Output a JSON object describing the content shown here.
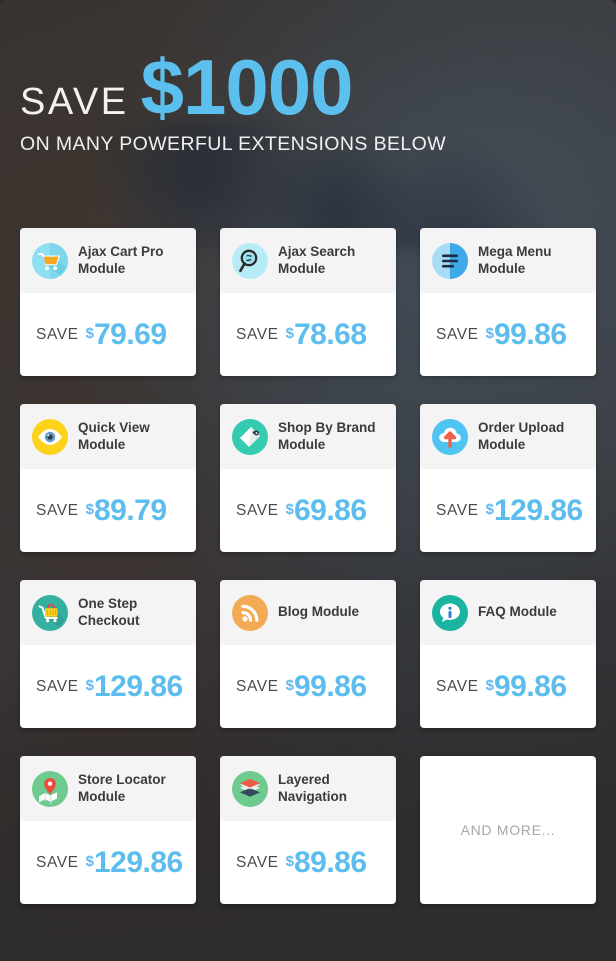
{
  "hero": {
    "save_word": "SAVE",
    "amount": "$1000",
    "subtitle": "ON MANY POWERFUL EXTENSIONS BELOW"
  },
  "labels": {
    "save": "SAVE",
    "currency": "$"
  },
  "colors": {
    "accent_blue": "#5cbdee",
    "card_header_bg": "#f4f4f5",
    "card_bg": "#ffffff",
    "title_text": "#3b3b3b",
    "background_dark": "#343230"
  },
  "cards": [
    {
      "title": "Ajax Cart Pro Module",
      "icon": "shopping-cart-icon",
      "save_label": "SAVE",
      "currency": "$",
      "value": "79.69"
    },
    {
      "title": "Ajax Search Module",
      "icon": "magnifier-search-icon",
      "save_label": "SAVE",
      "currency": "$",
      "value": "78.68"
    },
    {
      "title": "Mega Menu Module",
      "icon": "menu-lines-icon",
      "save_label": "SAVE",
      "currency": "$",
      "value": "99.86"
    },
    {
      "title": "Quick View Module",
      "icon": "eye-icon",
      "save_label": "SAVE",
      "currency": "$",
      "value": "89.79"
    },
    {
      "title": "Shop By Brand Module",
      "icon": "price-tag-icon",
      "save_label": "SAVE",
      "currency": "$",
      "value": "69.86"
    },
    {
      "title": "Order Upload Module",
      "icon": "cloud-upload-icon",
      "save_label": "SAVE",
      "currency": "$",
      "value": "129.86"
    },
    {
      "title": "One Step Checkout",
      "icon": "shopping-basket-icon",
      "save_label": "SAVE",
      "currency": "$",
      "value": "129.86"
    },
    {
      "title": "Blog Module",
      "icon": "rss-feed-icon",
      "save_label": "SAVE",
      "currency": "$",
      "value": "99.86"
    },
    {
      "title": "FAQ Module",
      "icon": "info-bubble-icon",
      "save_label": "SAVE",
      "currency": "$",
      "value": "99.86"
    },
    {
      "title": "Store Locator Module",
      "icon": "map-pin-icon",
      "save_label": "SAVE",
      "currency": "$",
      "value": "129.86"
    },
    {
      "title": "Layered Navigation",
      "icon": "layers-stack-icon",
      "save_label": "SAVE",
      "currency": "$",
      "value": "89.86"
    }
  ],
  "more_card": {
    "text": "AND MORE..."
  }
}
